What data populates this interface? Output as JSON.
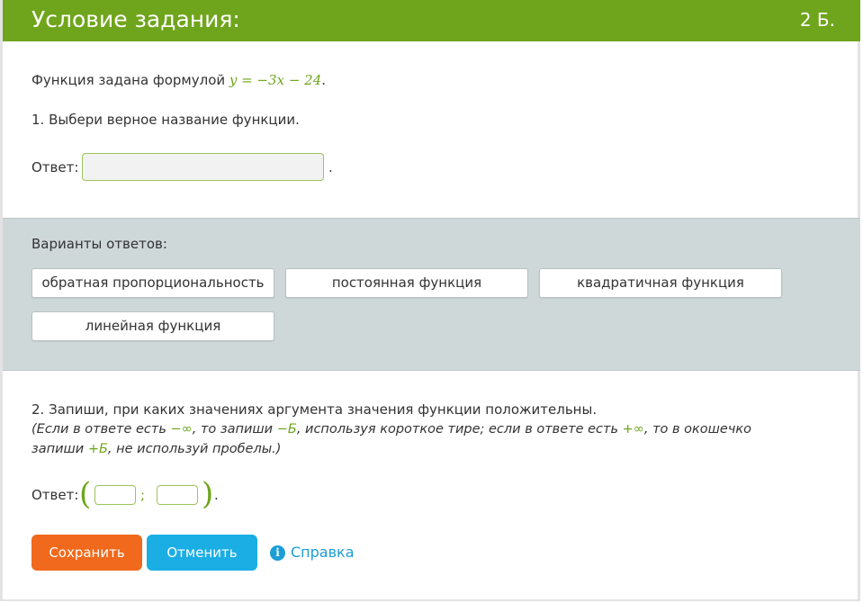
{
  "header": {
    "title": "Условие задания:",
    "points": "2 Б."
  },
  "task": {
    "intro": "Функция задана формулой ",
    "formula": "y = −3x − 24",
    "intro_end": ".",
    "q1": "1. Выбери верное название функции.",
    "answer_label": "Ответ:",
    "answer_value": "",
    "answer_suffix": "."
  },
  "variants": {
    "title": "Варианты ответов:",
    "options": [
      "обратная пропорциональность",
      "постоянная функция",
      "квадратичная функция",
      "линейная функция"
    ]
  },
  "q2": {
    "line1": "2. Запиши, при каких значениях аргумента значения функции положительны.",
    "note_p1": "(Если в ответе есть ",
    "minus_inf": "−∞",
    "note_p2": ", то запиши ",
    "minus_b": "−Б",
    "note_p3": ", используя короткое тире; если в ответе есть ",
    "plus_inf": "+∞",
    "note_p4": ", то в окошечко",
    "note_p5": "запиши ",
    "plus_b": "+Б",
    "note_p6": ", не используй пробелы.)",
    "answer_label": "Ответ:",
    "open_paren": "(",
    "separator": ";",
    "close_paren": ")",
    "suffix": ".",
    "left_value": "",
    "right_value": ""
  },
  "actions": {
    "save": "Сохранить",
    "cancel": "Отменить",
    "help": "Справка",
    "help_icon": "i"
  },
  "colors": {
    "header": "#6fa51c",
    "save": "#f0691c",
    "cancel": "#1aaee5",
    "link": "#1b9dd5"
  }
}
